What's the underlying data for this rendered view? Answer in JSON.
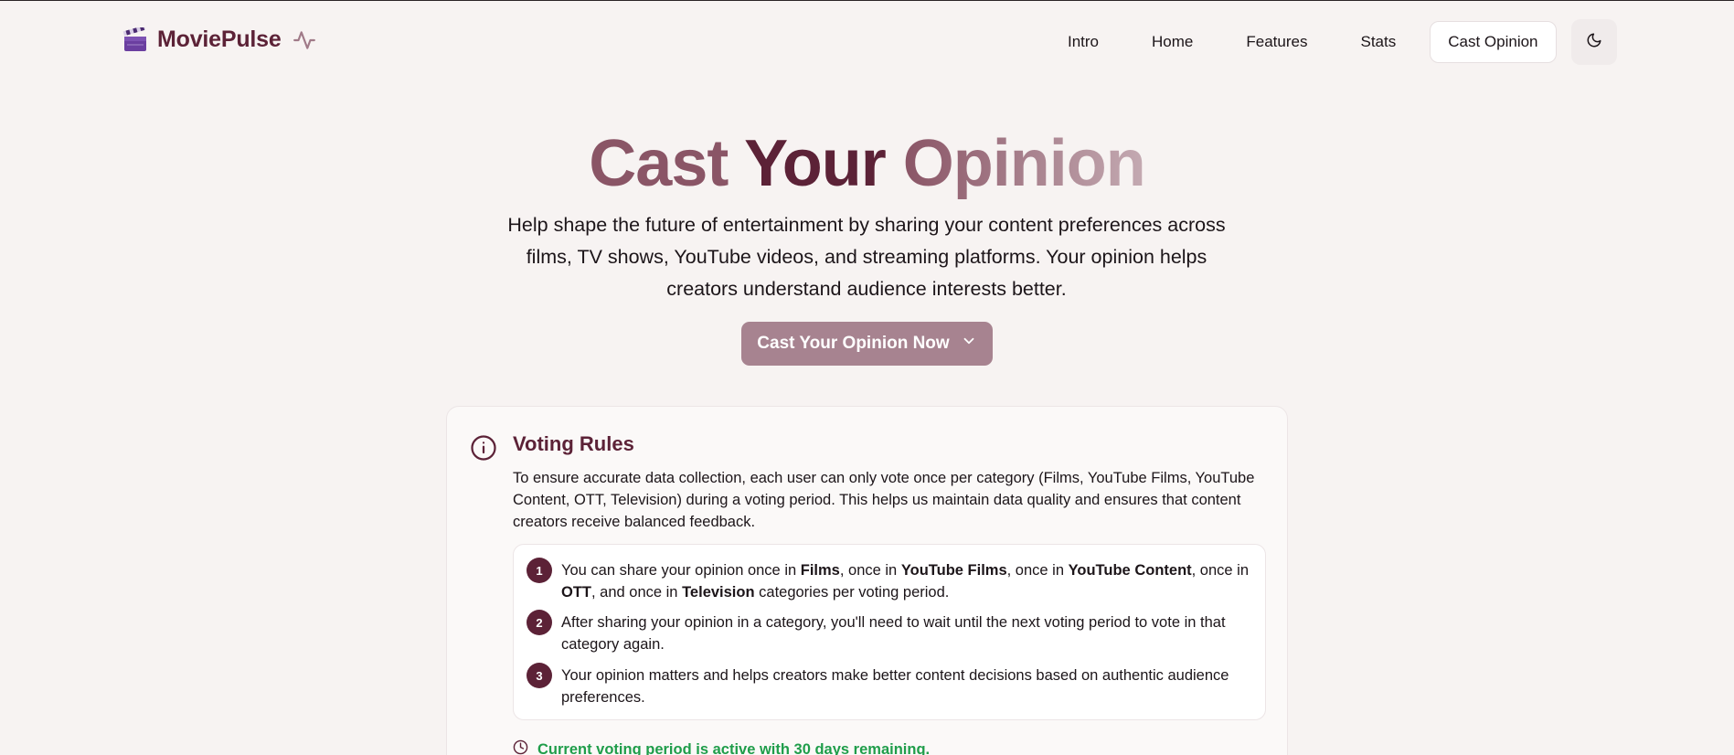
{
  "brand": {
    "name": "MoviePulse",
    "logo_icon": "clapperboard-icon",
    "pulse_icon": "activity-icon"
  },
  "nav": {
    "items": [
      "Intro",
      "Home",
      "Features",
      "Stats"
    ],
    "cta": "Cast Opinion",
    "theme_icon": "moon-icon"
  },
  "hero": {
    "title_parts": [
      "Cast",
      "Your",
      "Opinion"
    ],
    "subtitle": "Help shape the future of entertainment by sharing your content preferences across films, TV shows, YouTube videos, and streaming platforms. Your opinion helps creators understand audience interests better.",
    "cta": "Cast Your Opinion Now",
    "cta_icon": "chevron-down-icon"
  },
  "rules_card": {
    "title": "Voting Rules",
    "description": "To ensure accurate data collection, each user can only vote once per category (Films, YouTube Films, YouTube Content, OTT, Television) during a voting period. This helps us maintain data quality and ensures that content creators receive balanced feedback.",
    "rules": [
      {
        "num": "1",
        "segments": [
          {
            "t": "You can share your opinion once in ",
            "b": false
          },
          {
            "t": "Films",
            "b": true
          },
          {
            "t": ", once in ",
            "b": false
          },
          {
            "t": "YouTube Films",
            "b": true
          },
          {
            "t": ", once in ",
            "b": false
          },
          {
            "t": "YouTube Content",
            "b": true
          },
          {
            "t": ", once in ",
            "b": false
          },
          {
            "t": "OTT",
            "b": true
          },
          {
            "t": ", and once in ",
            "b": false
          },
          {
            "t": "Television",
            "b": true
          },
          {
            "t": " categories per voting period.",
            "b": false
          }
        ]
      },
      {
        "num": "2",
        "segments": [
          {
            "t": "After sharing your opinion in a category, you'll need to wait until the next voting period to vote in that category again.",
            "b": false
          }
        ]
      },
      {
        "num": "3",
        "segments": [
          {
            "t": "Your opinion matters and helps creators make better content decisions based on authentic audience preferences.",
            "b": false
          }
        ]
      }
    ],
    "status": "Current voting period is active with 30 days remaining.",
    "status_icon": "clock-icon"
  },
  "colors": {
    "background": "#f7f3f2",
    "brand": "#5c2237",
    "cta": "#a78390",
    "success": "#1f9d4a"
  }
}
